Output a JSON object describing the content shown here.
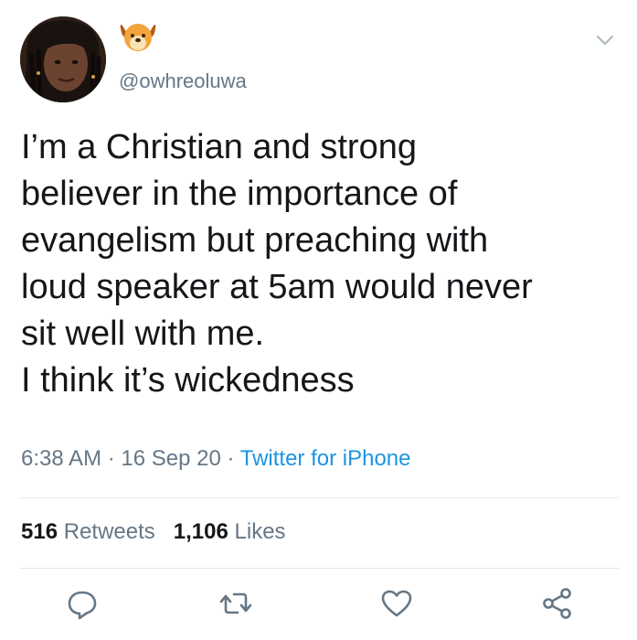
{
  "user": {
    "handle": "@owhreoluwa",
    "avatar_icon": "profile-photo",
    "badge_icon": "dog-face-emoji"
  },
  "tweet": {
    "text": "I’m a Christian and strong\nbeliever in the importance of\nevangelism but preaching with\nloud speaker at 5am would never\nsit well with me.\nI think it’s wickedness",
    "time": "6:38 AM",
    "separator": " · ",
    "date": "16 Sep 20",
    "source": "Twitter for iPhone"
  },
  "stats": {
    "retweets_count": "516",
    "retweets_label": "Retweets",
    "likes_count": "1,106",
    "likes_label": "Likes"
  },
  "actions": {
    "reply_icon": "reply-icon",
    "retweet_icon": "retweet-icon",
    "like_icon": "heart-icon",
    "share_icon": "share-icon"
  },
  "colors": {
    "text": "#14171a",
    "muted": "#657786",
    "link": "#1b95e0",
    "divider": "#e1e8ed"
  }
}
